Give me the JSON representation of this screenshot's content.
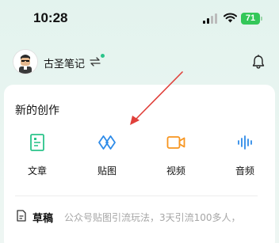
{
  "status_bar": {
    "time": "10:28",
    "battery": "71",
    "icons": [
      "signal-icon",
      "wifi-icon",
      "battery-icon"
    ],
    "battery_color": "#34c759"
  },
  "header": {
    "username": "古圣笔记",
    "switch_icon": "switch-account-icon",
    "notification_icon": "bell-icon",
    "online_color": "#2bc48a"
  },
  "create": {
    "title": "新的创作",
    "tools": [
      {
        "label": "文章",
        "icon": "article-icon",
        "color": "#2bc48a"
      },
      {
        "label": "贴图",
        "icon": "image-post-icon",
        "color": "#2e8be8"
      },
      {
        "label": "视频",
        "icon": "video-icon",
        "color": "#f7951f"
      },
      {
        "label": "音频",
        "icon": "audio-icon",
        "color": "#2e8be8"
      }
    ]
  },
  "draft": {
    "label": "草稿",
    "preview": "公众号贴图引流玩法，3天引流100多人，",
    "icon": "draft-document-icon"
  },
  "annotation": {
    "arrow_color": "#e0403a",
    "icon": "red-arrow-annotation"
  }
}
